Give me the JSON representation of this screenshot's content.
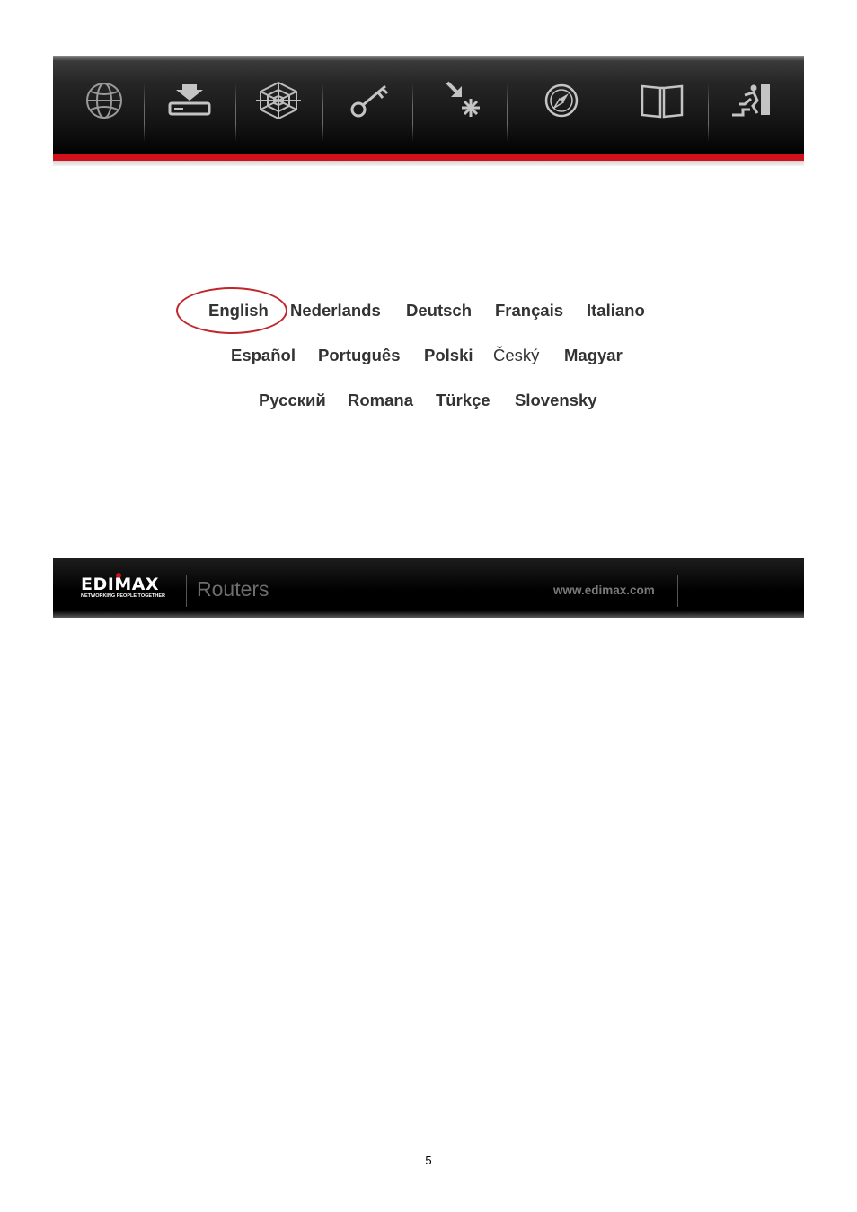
{
  "header": {
    "nav_icons": [
      "globe-icon",
      "download-device-icon",
      "spider-web-icon",
      "key-icon",
      "star-arrow-icon",
      "compass-icon",
      "open-book-icon",
      "exit-stairs-icon"
    ],
    "accent_color": "#d0101a"
  },
  "languages": {
    "row1": [
      "English",
      "Nederlands",
      "Deutsch",
      "Français",
      "Italiano"
    ],
    "row2": [
      "Español",
      "Português",
      "Polski",
      "Český",
      "Magyar"
    ],
    "row3": [
      "Русский",
      "Romana",
      "Türkçe",
      "Slovensky"
    ],
    "selected": "English"
  },
  "footer": {
    "logo": "EDIMAX",
    "logo_tagline": "NETWORKING PEOPLE TOGETHER",
    "title": "Routers",
    "url": "www.edimax.com"
  },
  "page": {
    "number": "5"
  }
}
